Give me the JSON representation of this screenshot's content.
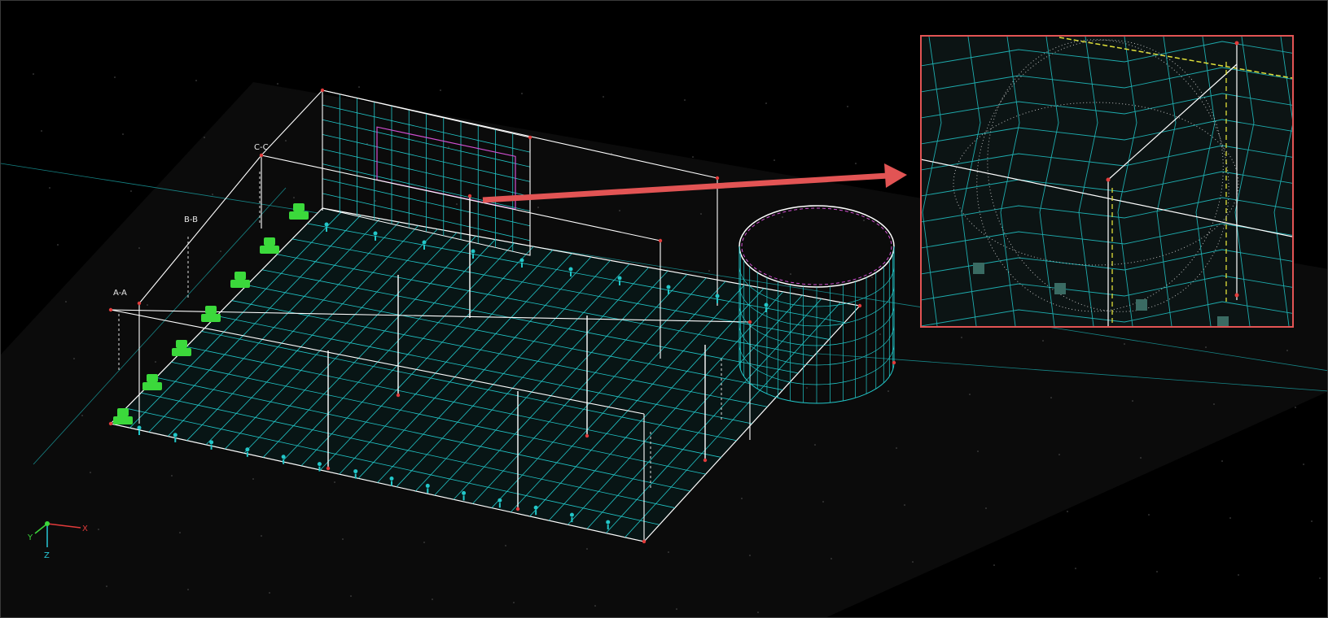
{
  "viewport": {
    "background": "#000000",
    "ground_color": "#0b0b0b",
    "mesh_color": "#22c7c9",
    "edge_color": "#ffffff",
    "support_color": "#3bd93b",
    "highlight_color": "#e25454"
  },
  "sections": [
    {
      "id": "A-A",
      "label": "A-A"
    },
    {
      "id": "B-B",
      "label": "B-B"
    },
    {
      "id": "C-C",
      "label": "C-C"
    }
  ],
  "axis_triad": {
    "x_label": "X",
    "y_label": "Y",
    "z_label": "Z",
    "x_color": "#e23b3b",
    "y_color": "#3bd93b",
    "z_color": "#27c7d6"
  },
  "detail_view": {
    "border_color": "#e25454",
    "description_icon": "zoom-detail-icon"
  },
  "icons": {
    "support": "fixed-support-icon",
    "load": "point-load-icon",
    "arrow": "callout-arrow-icon"
  }
}
